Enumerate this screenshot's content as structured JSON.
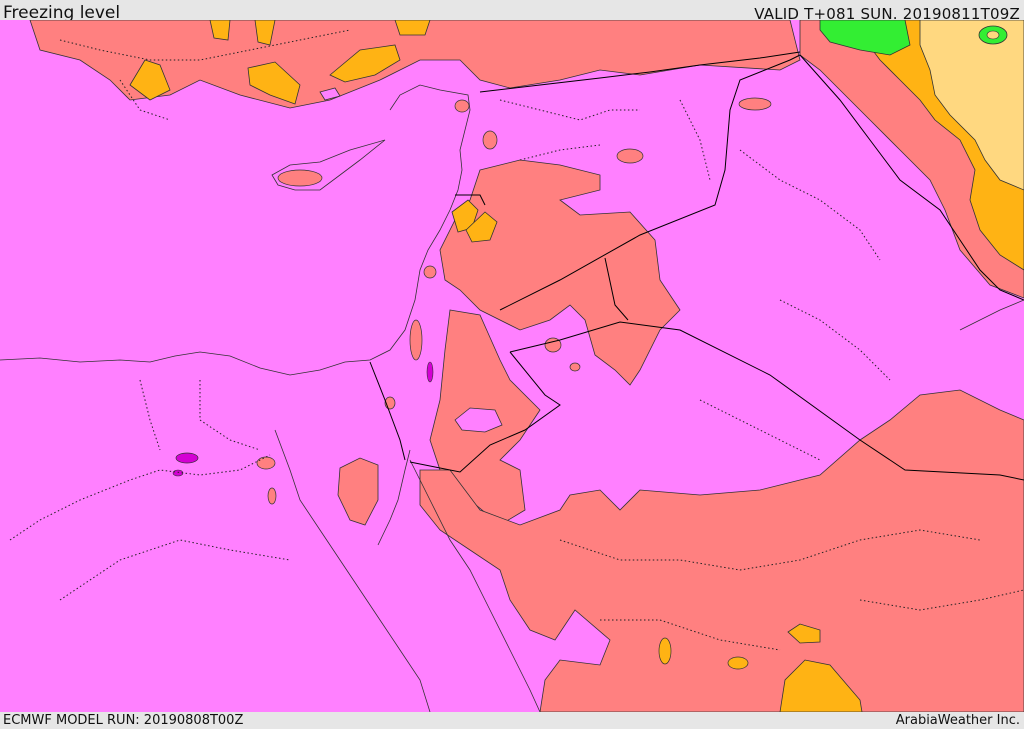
{
  "header": {
    "title": "Freezing level",
    "valid": "VALID T+081 SUN. 20190811T09Z"
  },
  "footer": {
    "model_run": "ECMWF MODEL RUN: 20190808T00Z",
    "credit": "ArabiaWeather Inc."
  },
  "map": {
    "variable": "Freezing level",
    "colors": {
      "magenta": "#ff80ff",
      "salmon": "#ff8080",
      "orange": "#ffb314",
      "lightyellow": "#ffd880",
      "green": "#33ee33",
      "purple": "#d400d4"
    }
  }
}
